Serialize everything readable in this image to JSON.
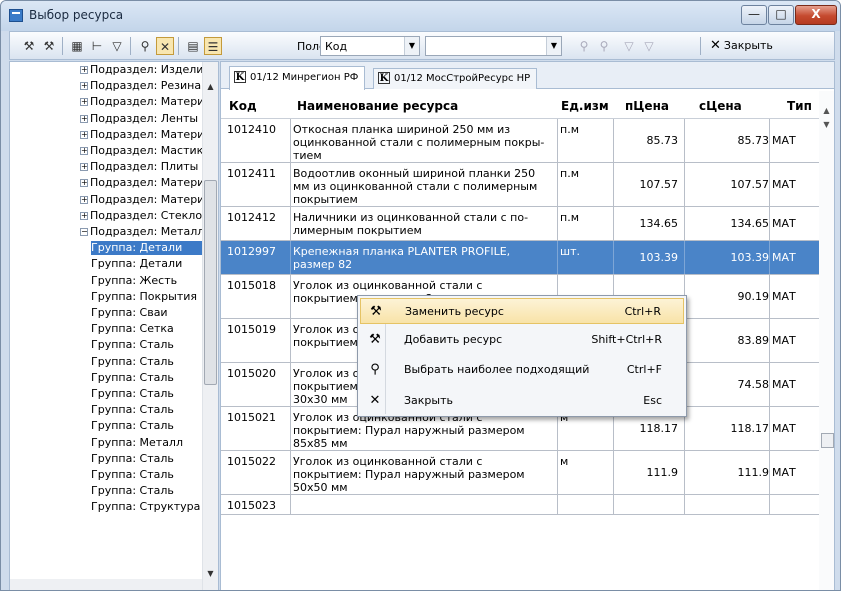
{
  "window": {
    "title": "Выбор ресурса",
    "min": "—",
    "max": "□",
    "close": "X"
  },
  "toolbar": {
    "field_label": "Поле",
    "field_value": "Код",
    "value_value": "",
    "close_label": "Закрыть"
  },
  "tree": {
    "items": [
      {
        "label": "Подраздел: Изделия",
        "pm": "+"
      },
      {
        "label": "Подраздел: Резина",
        "pm": "+"
      },
      {
        "label": "Подраздел: Материалы",
        "pm": "+"
      },
      {
        "label": "Подраздел: Ленты",
        "pm": "+"
      },
      {
        "label": "Подраздел: Материалы",
        "pm": "+"
      },
      {
        "label": "Подраздел: Мастики",
        "pm": "+"
      },
      {
        "label": "Подраздел: Плиты",
        "pm": "+"
      },
      {
        "label": "Подраздел: Материалы",
        "pm": "+"
      },
      {
        "label": "Подраздел: Материалы",
        "pm": "+"
      },
      {
        "label": "Подраздел: Стекло",
        "pm": "+"
      },
      {
        "label": "Подраздел: Металл",
        "pm": "−"
      },
      {
        "label": "Группа: Детали",
        "pm": "",
        "selected": true
      },
      {
        "label": "Группа: Детали",
        "pm": ""
      },
      {
        "label": "Группа: Жесть",
        "pm": ""
      },
      {
        "label": "Группа: Покрытия",
        "pm": ""
      },
      {
        "label": "Группа: Сваи",
        "pm": ""
      },
      {
        "label": "Группа: Сетка",
        "pm": ""
      },
      {
        "label": "Группа: Сталь",
        "pm": ""
      },
      {
        "label": "Группа: Сталь",
        "pm": ""
      },
      {
        "label": "Группа: Сталь",
        "pm": ""
      },
      {
        "label": "Группа: Сталь",
        "pm": ""
      },
      {
        "label": "Группа: Сталь",
        "pm": ""
      },
      {
        "label": "Группа: Сталь",
        "pm": ""
      },
      {
        "label": "Группа: Металл",
        "pm": ""
      },
      {
        "label": "Группа: Сталь",
        "pm": ""
      },
      {
        "label": "Группа: Сталь",
        "pm": ""
      },
      {
        "label": "Группа: Сталь",
        "pm": ""
      },
      {
        "label": "Группа: Структура",
        "pm": ""
      }
    ]
  },
  "tabs": [
    {
      "label": "01/12 Минрегион РФ",
      "icon": "K"
    },
    {
      "label": "01/12 МосСтройРесурс НР",
      "icon": "K"
    }
  ],
  "columns": [
    "Код",
    "Наименование ресурса",
    "Ед.изм",
    "пЦена",
    "сЦена",
    "Тип"
  ],
  "rows": [
    {
      "code": "1012410",
      "name": "Откосная планка шириной 250 мм из оцинкованной стали с полимерным покры-тием",
      "unit": "п.м",
      "p1": "85.73",
      "p2": "85.73",
      "type": "МАТ"
    },
    {
      "code": "1012411",
      "name": "Водоотлив оконный шириной планки 250 мм из оцинкованной стали с полимерным покрытием",
      "unit": "п.м",
      "p1": "107.57",
      "p2": "107.57",
      "type": "МАТ"
    },
    {
      "code": "1012412",
      "name": "Наличники из оцинкованной стали с по-лимерным покрытием",
      "unit": "п.м",
      "p1": "134.65",
      "p2": "134.65",
      "type": "МАТ"
    },
    {
      "code": "1012997",
      "name": "Крепежная планка PLANTER PROFILE, размер 82",
      "unit": "шт.",
      "p1": "103.39",
      "p2": "103.39",
      "type": "МАТ"
    },
    {
      "code": "1015018",
      "name": "Уголок из оцинкованной стали с покрытием: размером 8",
      "unit": "",
      "p1": "",
      "p2": "90.19",
      "type": "МАТ"
    },
    {
      "code": "1015019",
      "name": "Уголок из оцинкованной стали с покрытием: размером 5",
      "unit": "",
      "p1": "",
      "p2": "83.89",
      "type": "МАТ"
    },
    {
      "code": "1015020",
      "name": "Уголок из оцинкованной стали с покрытием: Полиэстер наружный размером 30х30 мм",
      "unit": "м",
      "p1": "74.58",
      "p2": "74.58",
      "type": "МАТ"
    },
    {
      "code": "1015021",
      "name": "Уголок из оцинкованной стали с покрытием: Пурал наружный размером 85х85 мм",
      "unit": "м",
      "p1": "118.17",
      "p2": "118.17",
      "type": "МАТ"
    },
    {
      "code": "1015022",
      "name": "Уголок из оцинкованной стали с покрытием: Пурал наружный размером 50х50 мм",
      "unit": "м",
      "p1": "111.9",
      "p2": "111.9",
      "type": "МАТ"
    },
    {
      "code": "1015023",
      "name": "",
      "unit": "",
      "p1": "",
      "p2": "",
      "type": ""
    }
  ],
  "context_menu": [
    {
      "label": "Заменить ресурс",
      "key": "Ctrl+R",
      "icon": "hammer-icon"
    },
    {
      "label": "Добавить ресурс",
      "key": "Shift+Ctrl+R",
      "icon": "hammer-add-icon"
    },
    {
      "label": "Выбрать наиболее подходящий",
      "key": "Ctrl+F",
      "icon": "binoculars-icon"
    },
    {
      "label": "Закрыть",
      "key": "Esc",
      "icon": "close-icon"
    }
  ]
}
